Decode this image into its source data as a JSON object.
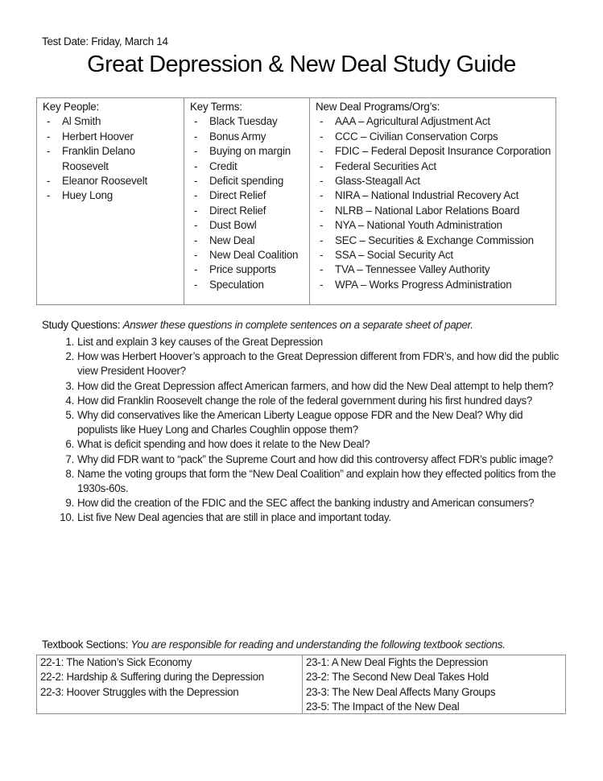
{
  "header": {
    "test_date": "Test Date: Friday, March 14",
    "title": "Great Depression & New Deal Study Guide"
  },
  "key_people": {
    "heading": "Key People:",
    "items": [
      "Al Smith",
      "Herbert Hoover",
      "Franklin Delano Roosevelt",
      "Eleanor Roosevelt",
      "Huey Long"
    ]
  },
  "key_terms": {
    "heading": "Key Terms:",
    "items": [
      "Black Tuesday",
      "Bonus Army",
      "Buying on margin",
      "Credit",
      "Deficit spending",
      "Direct Relief",
      "Direct Relief",
      "Dust Bowl",
      "New Deal",
      "New Deal Coalition",
      "Price supports",
      "Speculation"
    ]
  },
  "programs": {
    "heading": "New Deal Programs/Org’s:",
    "items": [
      "AAA – Agricultural Adjustment Act",
      "CCC – Civilian Conservation Corps",
      "FDIC – Federal Deposit Insurance Corporation",
      "Federal Securities Act",
      "Glass-Steagall Act",
      "NIRA – National Industrial Recovery Act",
      "NLRB – National Labor Relations Board",
      "NYA – National Youth Administration",
      "SEC – Securities & Exchange Commission",
      "SSA – Social Security Act",
      "TVA – Tennessee Valley Authority",
      "WPA – Works Progress Administration"
    ]
  },
  "study_questions": {
    "heading": "Study Questions:",
    "note": "Answer these questions in complete sentences on a separate sheet of paper.",
    "items": [
      "List and explain 3 key causes of the Great Depression",
      "How was Herbert Hoover’s approach to the Great Depression different from FDR’s, and how did the public view President Hoover?",
      "How did the Great Depression affect American farmers, and how did the New Deal attempt to help them?",
      "How did Franklin Roosevelt change the role of the federal government during his first hundred days?",
      "Why did conservatives like the American Liberty League oppose FDR and the New Deal? Why did populists like Huey Long and Charles Coughlin oppose them?",
      "What is deficit spending and how does it relate to the New Deal?",
      "Why did FDR want to “pack” the Supreme Court and how did this controversy affect FDR’s public image?",
      "Name the voting groups that form the “New Deal Coalition” and explain how they effected politics from the 1930s-60s.",
      "How did the creation of the FDIC and the SEC affect the banking industry and American consumers?",
      "List five New Deal agencies that are still in place and important today."
    ]
  },
  "textbook_sections": {
    "heading": "Textbook Sections:",
    "note": "You are responsible for reading and understanding the following textbook sections.",
    "left": [
      "22-1: The Nation’s Sick Economy",
      "22-2: Hardship & Suffering during the Depression",
      "22-3: Hoover Struggles with the Depression"
    ],
    "right": [
      "23-1: A New Deal Fights the Depression",
      "23-2: The Second New Deal Takes Hold",
      "23-3: The New Deal Affects Many Groups",
      "23-5: The Impact of the New Deal"
    ]
  }
}
